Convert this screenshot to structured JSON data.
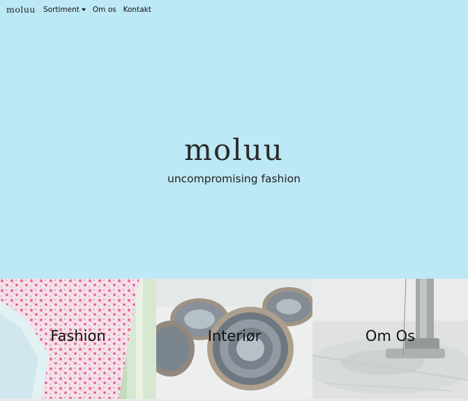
{
  "nav": {
    "brand": "moluu",
    "items": [
      {
        "label": "Sortiment",
        "dropdown": true
      },
      {
        "label": "Om os",
        "dropdown": false
      },
      {
        "label": "Kontakt",
        "dropdown": false
      }
    ]
  },
  "hero": {
    "title": "moluu",
    "subtitle": "uncompromising fashion",
    "background_color": "#bde8f5"
  },
  "tiles": [
    {
      "label": "Fashion",
      "image": "floral-clothing-image"
    },
    {
      "label": "Interiør",
      "image": "agate-stones-image"
    },
    {
      "label": "Om Os",
      "image": "sewing-machine-image"
    }
  ]
}
